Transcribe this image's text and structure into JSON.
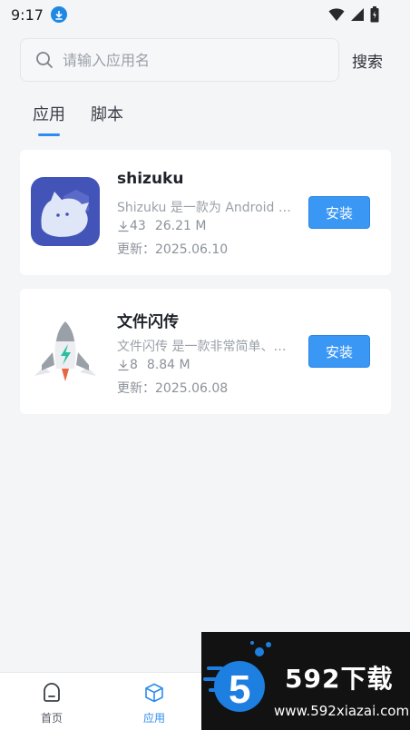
{
  "status_bar": {
    "time": "9:17"
  },
  "search": {
    "placeholder": "请输入应用名",
    "button_label": "搜索"
  },
  "tabs": [
    {
      "label": "应用",
      "active": true
    },
    {
      "label": "脚本",
      "active": false
    }
  ],
  "apps": [
    {
      "name": "shizuku",
      "description": "Shizuku 是一款为 Android 设备提供高级权限",
      "downloads": "43",
      "size": "26.21 M",
      "updated": "更新：2025.06.10",
      "install_label": "安装",
      "icon": "shizuku-app-icon"
    },
    {
      "name": "文件闪传",
      "description": "文件闪传 是一款非常简单、实用的文件传输工具",
      "downloads": "8",
      "size": "8.84 M",
      "updated": "更新：2025.06.08",
      "install_label": "安装",
      "icon": "rocket-app-icon"
    }
  ],
  "bottom_nav": [
    {
      "label": "首页",
      "icon": "home-icon",
      "active": false
    },
    {
      "label": "应用",
      "icon": "cube-icon",
      "active": true
    }
  ],
  "watermark": {
    "title": "592下载",
    "url": "www.592xiazai.com",
    "logo_digit": "5"
  },
  "colors": {
    "accent": "#2d8cf0",
    "install_button": "#3a97f4",
    "background": "#f4f5f7"
  }
}
